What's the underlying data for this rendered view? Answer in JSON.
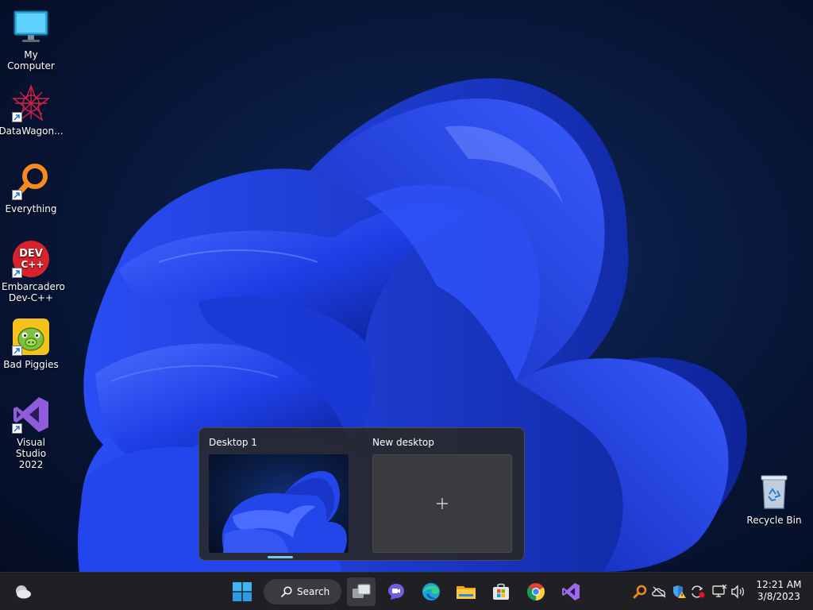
{
  "desktop": {
    "icons": [
      {
        "label": "My Computer",
        "icon": "monitor-icon"
      },
      {
        "label": "DataWagon...",
        "icon": "datawagon-icon"
      },
      {
        "label": "Everything",
        "icon": "magnifier-icon"
      },
      {
        "label": "Embarcadero Dev-C++",
        "icon": "devcpp-icon",
        "badge": "DEV C++"
      },
      {
        "label": "Bad Piggies",
        "icon": "bad-piggies-icon"
      },
      {
        "label": "Visual Studio 2022",
        "icon": "visual-studio-icon"
      },
      {
        "label": "Recycle Bin",
        "icon": "recycle-bin-icon"
      }
    ]
  },
  "taskview": {
    "desktops": [
      {
        "label": "Desktop 1",
        "active": true
      },
      {
        "label": "New desktop",
        "glyph": "+"
      }
    ]
  },
  "taskbar": {
    "widgets_icon": "weather-icon",
    "start_icon": "windows-logo-icon",
    "search_label": "Search",
    "pinned": [
      "task-view-icon",
      "teams-chat-icon",
      "edge-icon",
      "file-explorer-icon",
      "microsoft-store-icon",
      "chrome-icon",
      "visual-studio-icon"
    ],
    "tray": [
      "everything-tray-icon",
      "onedrive-offline-icon",
      "security-warning-icon",
      "sync-icon",
      "network-icon",
      "volume-icon"
    ],
    "clock": {
      "time": "12:21 AM",
      "date": "3/8/2023"
    }
  },
  "colors": {
    "taskbar": "#202024",
    "accent": "#76c7f0",
    "wallpaper_blue": "#1f3fe0"
  }
}
